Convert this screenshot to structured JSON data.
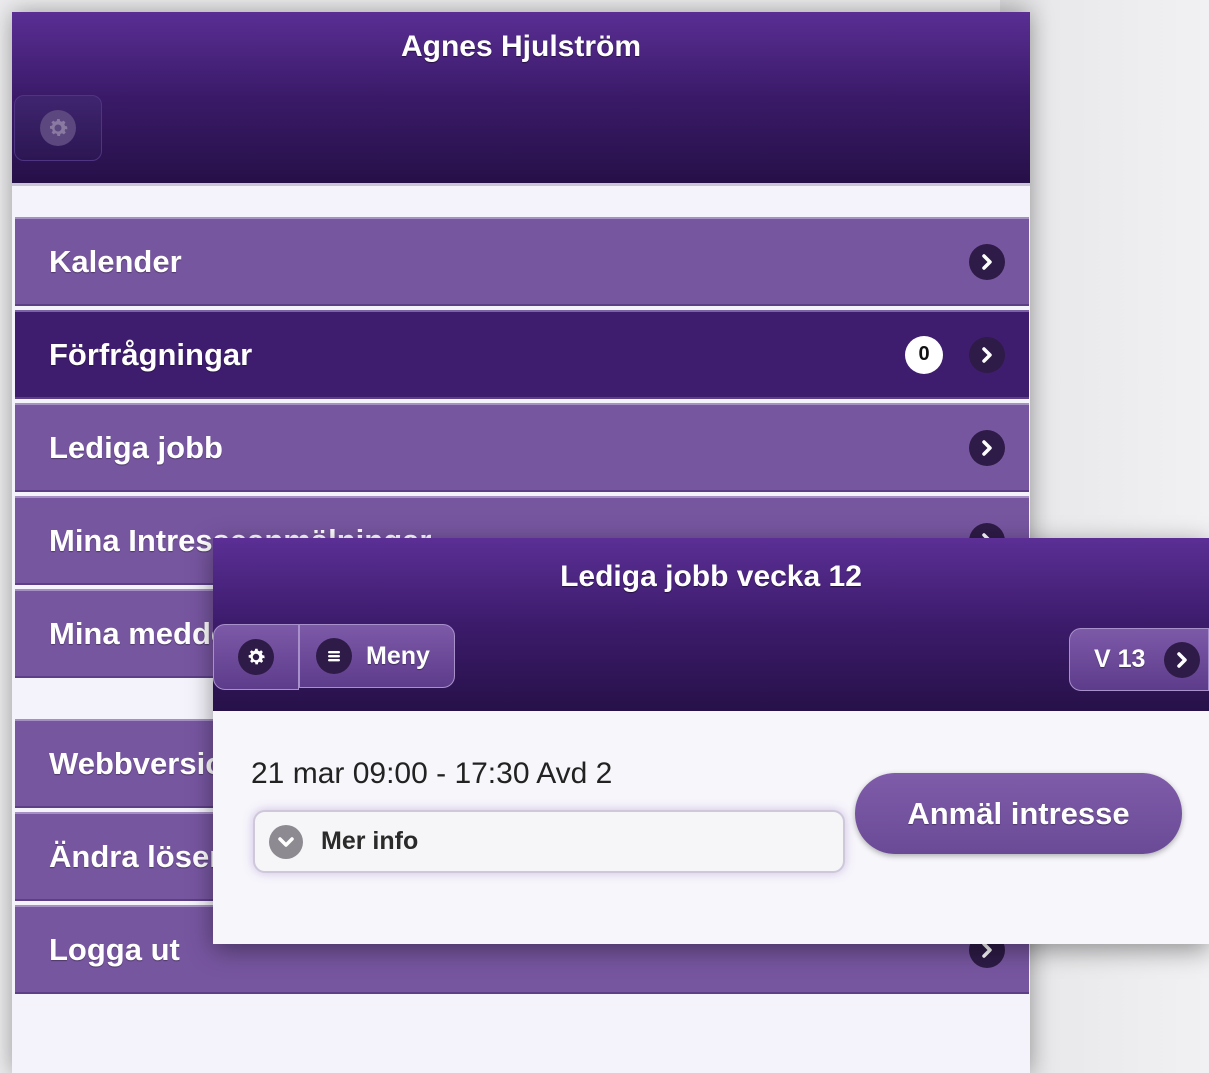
{
  "app": {
    "title": "Agnes Hjulström",
    "menu": [
      {
        "label": "Kalender"
      },
      {
        "label": "Förfrågningar",
        "badge": "0"
      },
      {
        "label": "Lediga jobb"
      },
      {
        "label": "Mina Intresseanmälningar"
      },
      {
        "label": "Mina meddelanden"
      },
      {
        "label": "Webbversion"
      },
      {
        "label": "Ändra lösenord"
      },
      {
        "label": "Logga ut"
      }
    ]
  },
  "panel": {
    "title": "Lediga jobb vecka 12",
    "meny_label": "Meny",
    "week_button": "V 13",
    "job": {
      "time": "21 mar 09:00 - 17:30 Avd 2",
      "more_info": "Mer info",
      "action": "Anmäl intresse"
    }
  },
  "colors": {
    "header_purple": "#3a1a68",
    "menu_purple": "#7756a0",
    "active_purple": "#3e1d6e",
    "button_purple": "#6a4a96"
  },
  "icons": [
    "gear-icon",
    "chevron-right-icon",
    "hamburger-icon",
    "chevron-down-icon"
  ]
}
